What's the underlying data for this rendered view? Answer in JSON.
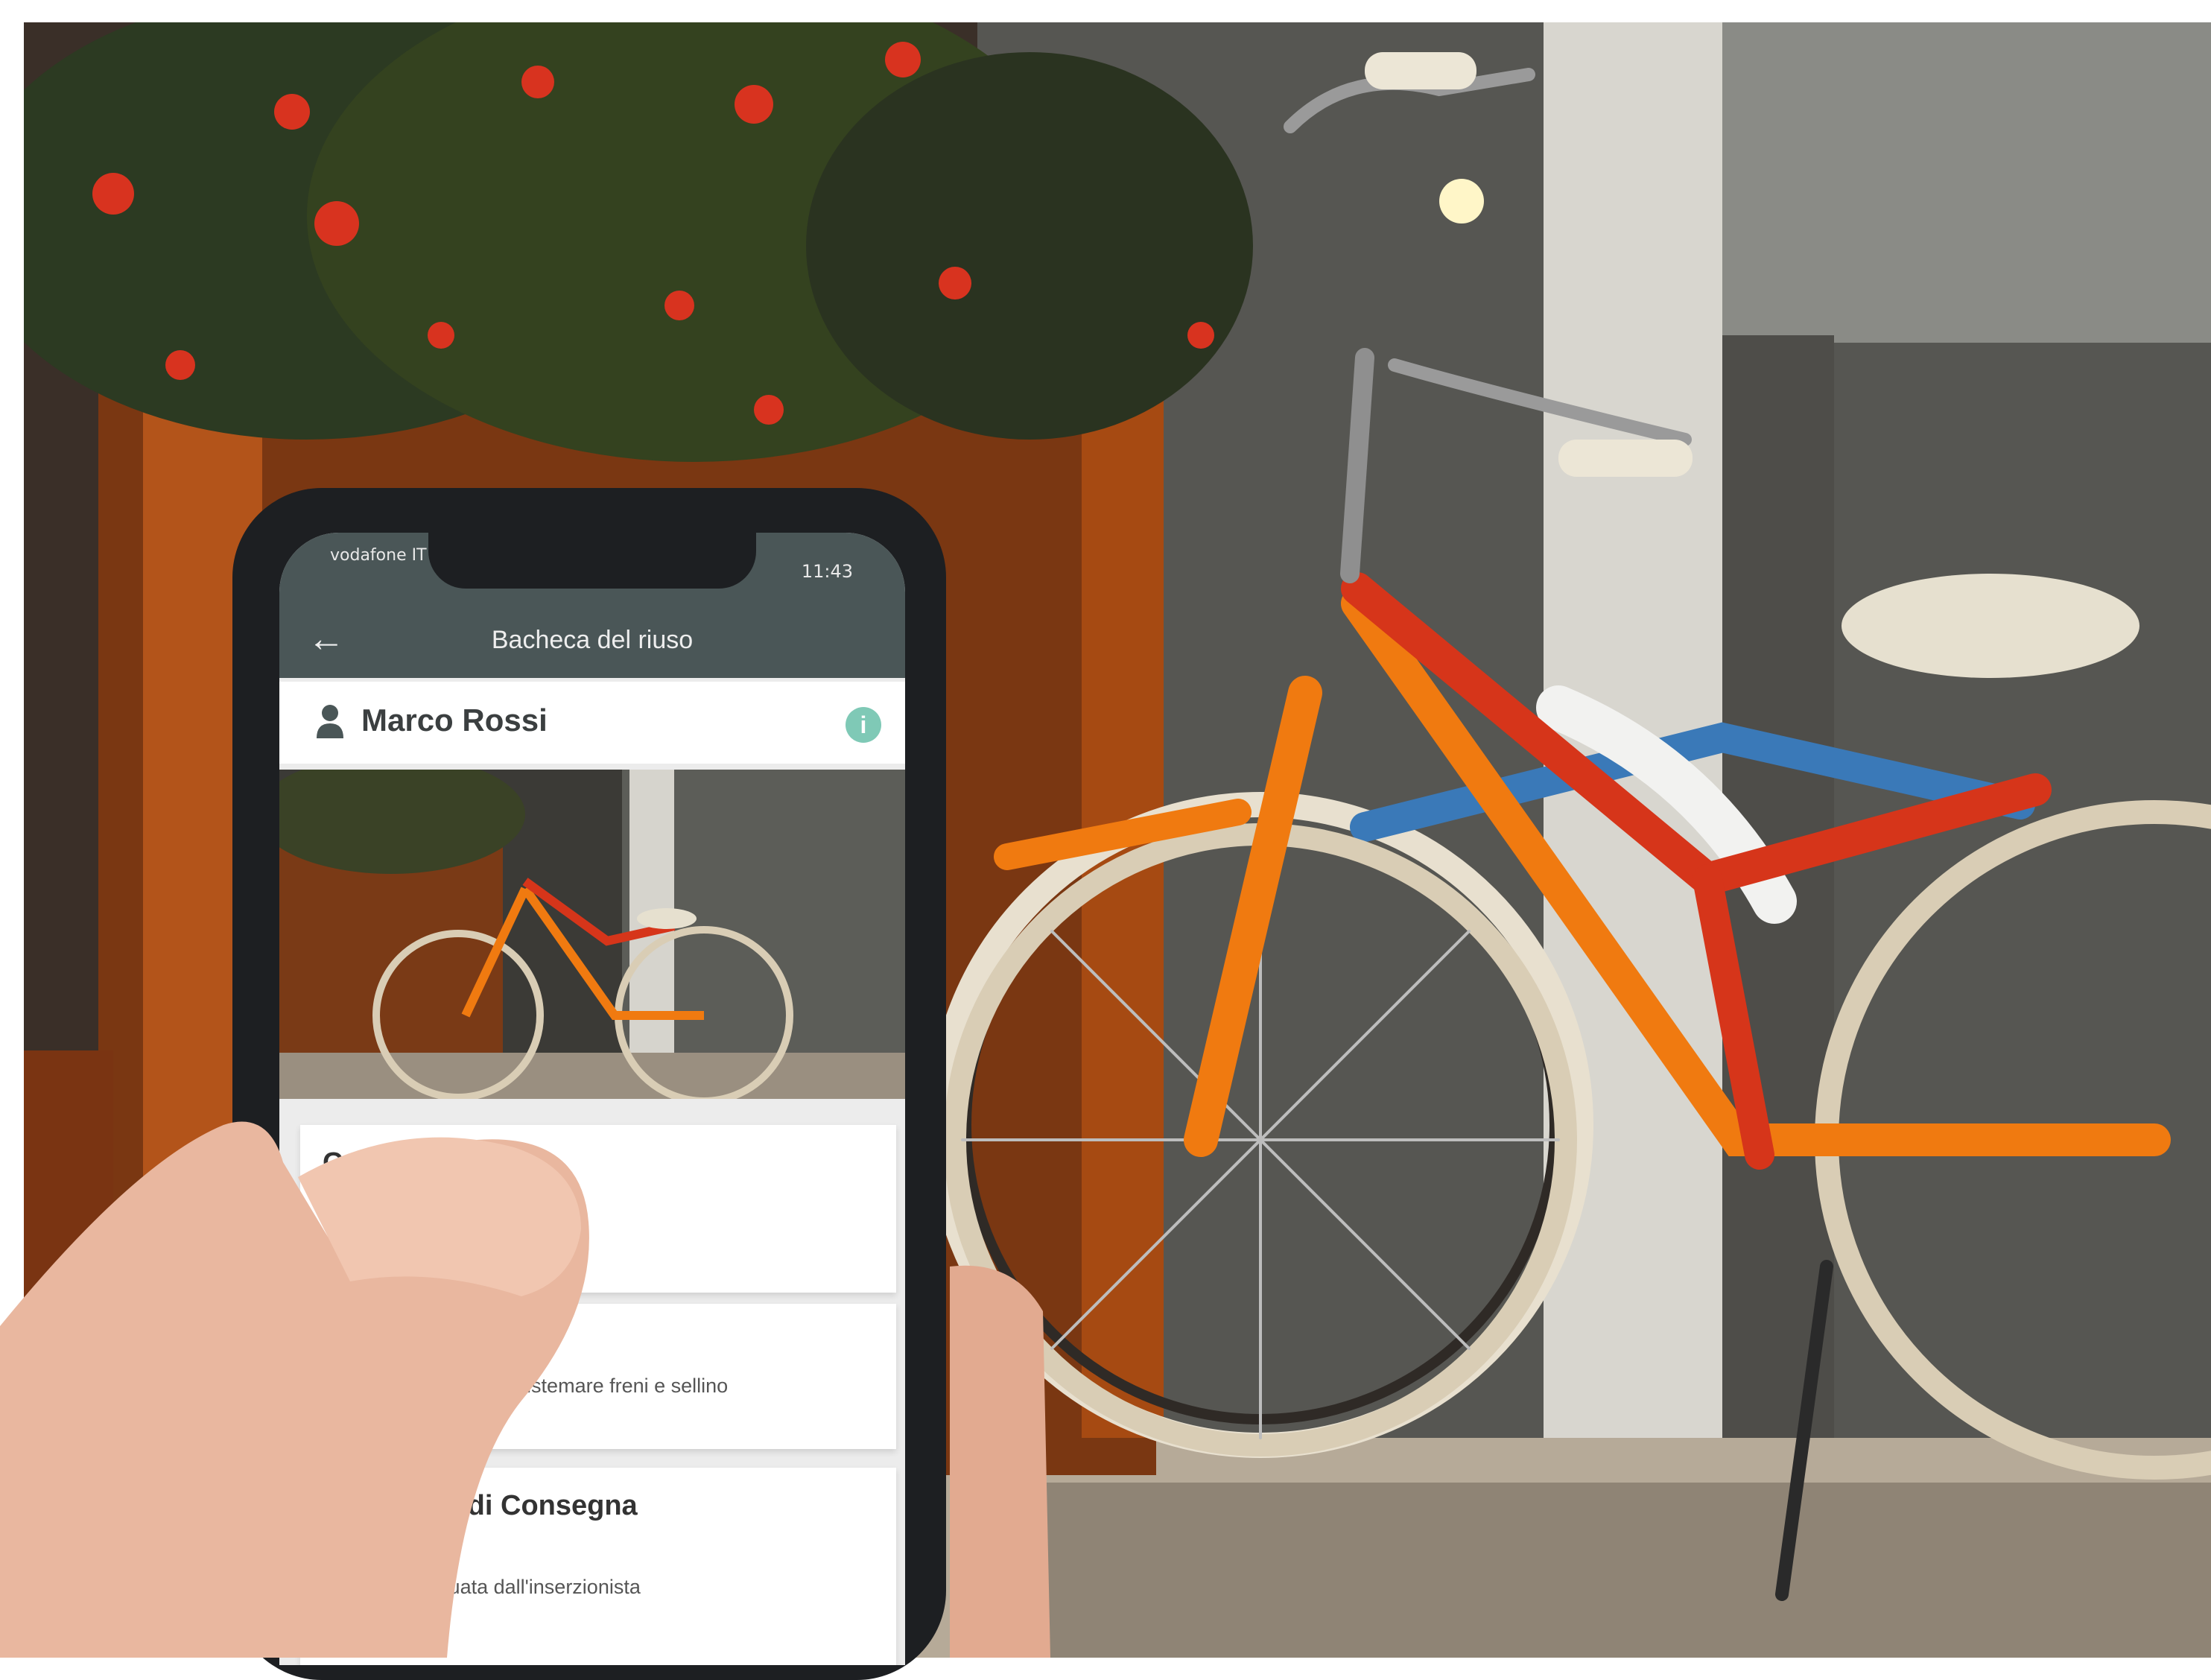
{
  "app": {
    "status_carrier": "vodafone IT",
    "status_time": "11:43",
    "title": "Bacheca del riuso",
    "user_name": "Marco Rossi"
  },
  "cards": {
    "category_title": "Categoria",
    "description_text": "superficie, sistemare freni e sellino",
    "delivery_title": "Modalità di Consegna",
    "delivery_text": "effettuata dall'inserzionista"
  },
  "colors": {
    "appbar": "#4a5657",
    "info_accent": "#7fc9b6",
    "bike_orange": "#f07a10",
    "bike_red": "#d6351a"
  }
}
